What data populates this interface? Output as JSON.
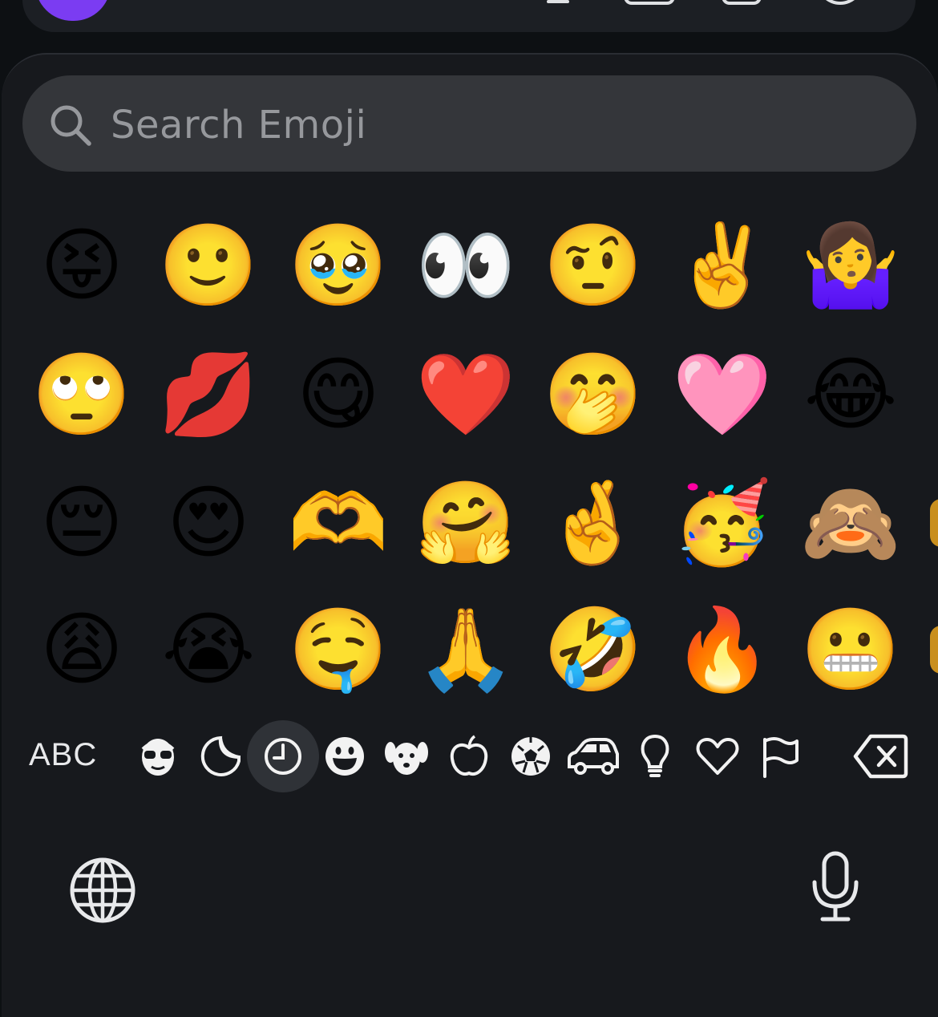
{
  "search": {
    "placeholder": "Search Emoji"
  },
  "emoji_rows": [
    [
      "😝",
      "🙂",
      "🥹",
      "👀",
      "🤨",
      "✌️",
      "🤷‍♀️"
    ],
    [
      "🙄",
      "💋",
      "😋",
      "❤️",
      "🤭",
      "🩷",
      "😂"
    ],
    [
      "😔",
      "😍",
      "🫶",
      "🤗",
      "🤞",
      "🥳",
      "🙈"
    ],
    [
      "😩",
      "😭",
      "🤤",
      "🙏",
      "🤣",
      "🔥",
      "😬"
    ]
  ],
  "categories": [
    {
      "name": "smileys-people-icon"
    },
    {
      "name": "stickers-icon"
    },
    {
      "name": "recents-icon",
      "active": true
    },
    {
      "name": "smiley-face-icon"
    },
    {
      "name": "animals-icon"
    },
    {
      "name": "food-icon"
    },
    {
      "name": "activity-icon"
    },
    {
      "name": "travel-icon"
    },
    {
      "name": "objects-icon"
    },
    {
      "name": "symbols-icon"
    },
    {
      "name": "flags-icon"
    }
  ],
  "keyboard": {
    "abc_label": "ABC"
  },
  "colors": {
    "keyboard_bg": "#17191d",
    "search_bg": "#34363a",
    "active_category_bg": "#2f3237",
    "avatar": "#7b3cf2"
  }
}
